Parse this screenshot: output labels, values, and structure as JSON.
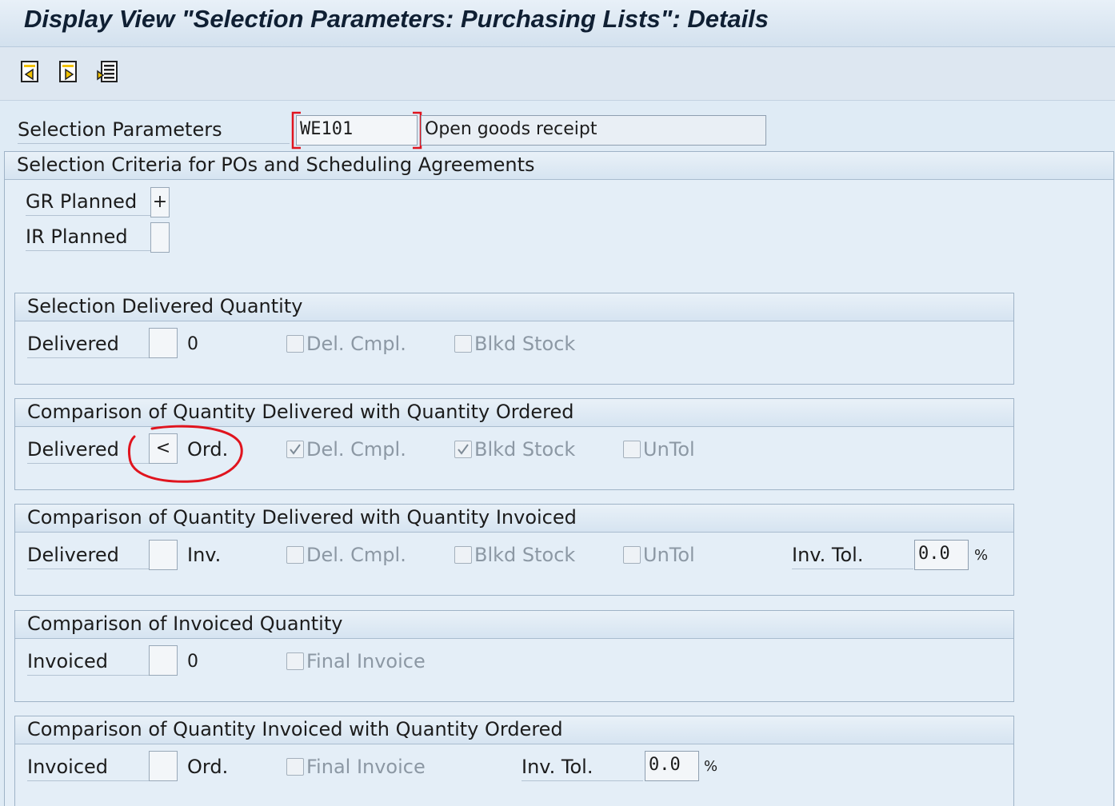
{
  "window": {
    "title": "Display View \"Selection Parameters: Purchasing Lists\": Details"
  },
  "toolbar": {
    "buttons": [
      {
        "name": "previous-entry-button",
        "icon": "previous-entry-icon"
      },
      {
        "name": "next-entry-button",
        "icon": "next-entry-icon"
      },
      {
        "name": "variable-list-button",
        "icon": "variable-list-icon"
      }
    ]
  },
  "header": {
    "label": "Selection Parameters",
    "code": "WE101",
    "description": "Open goods receipt"
  },
  "criteria": {
    "title": "Selection Criteria for POs and Scheduling Agreements",
    "gr_planned_label": "GR Planned",
    "gr_planned_value": "+",
    "ir_planned_label": "IR Planned",
    "ir_planned_value": ""
  },
  "sections": {
    "delivered_qty": {
      "title": "Selection Delivered Quantity",
      "label": "Delivered",
      "operator": "",
      "compare": "0",
      "del_cmpl": "Del. Cmpl.",
      "blkd_stock": "Blkd Stock",
      "del_cmpl_checked": false,
      "blkd_stock_checked": false
    },
    "delivered_vs_ordered": {
      "title": "Comparison of Quantity Delivered with Quantity Ordered",
      "label": "Delivered",
      "operator": "<",
      "compare": "Ord.",
      "del_cmpl": "Del. Cmpl.",
      "blkd_stock": "Blkd Stock",
      "untol": "UnTol",
      "del_cmpl_checked": true,
      "blkd_stock_checked": true,
      "untol_checked": false
    },
    "delivered_vs_invoiced": {
      "title": "Comparison of Quantity Delivered with Quantity Invoiced",
      "label": "Delivered",
      "operator": "",
      "compare": "Inv.",
      "del_cmpl": "Del. Cmpl.",
      "blkd_stock": "Blkd Stock",
      "untol": "UnTol",
      "inv_tol_label": "Inv. Tol.",
      "inv_tol_value": "0.0",
      "percent": "%"
    },
    "invoiced_qty": {
      "title": "Comparison of Invoiced Quantity",
      "label": "Invoiced",
      "operator": "",
      "compare": "0",
      "final_invoice": "Final Invoice"
    },
    "invoiced_vs_ordered": {
      "title": "Comparison of Quantity Invoiced with Quantity Ordered",
      "label": "Invoiced",
      "operator": "",
      "compare": "Ord.",
      "final_invoice": "Final Invoice",
      "inv_tol_label": "Inv. Tol.",
      "inv_tol_value": "0.0",
      "percent": "%"
    }
  },
  "colors": {
    "highlight_red": "#e0141e",
    "background": "#dfebf5"
  }
}
